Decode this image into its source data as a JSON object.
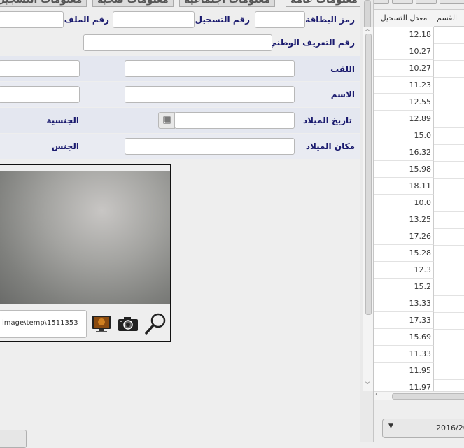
{
  "tabs": [
    "معلومات عامة",
    "معلومات اجتماعية",
    "معلومات صحية",
    "معلومات التسجيل"
  ],
  "form": {
    "card_code": "رمز البطاقة",
    "registration_number": "رقم التسجيل",
    "file_number": "رقم الملف",
    "national_id": "رقم التعريف الوطني",
    "last_name": "اللقب",
    "first_name": "الاسم",
    "birth_date": "تاريخ الميلاد",
    "nationality": "الجنسية",
    "birth_place": "مكان الميلاد",
    "gender": "الجنس"
  },
  "photo": {
    "path": "image\\temp\\1511353"
  },
  "table": {
    "headers": [
      "معدل التسجيل",
      "القسم"
    ],
    "rows": [
      "12.18",
      "10.27",
      "10.27",
      "11.23",
      "12.55",
      "12.89",
      "15.0",
      "16.32",
      "15.98",
      "18.11",
      "10.0",
      "13.25",
      "17.26",
      "15.28",
      "12.3",
      "15.2",
      "13.33",
      "17.33",
      "15.69",
      "11.33",
      "11.95",
      "11.97"
    ]
  },
  "year_select": {
    "value": "2016/20"
  }
}
